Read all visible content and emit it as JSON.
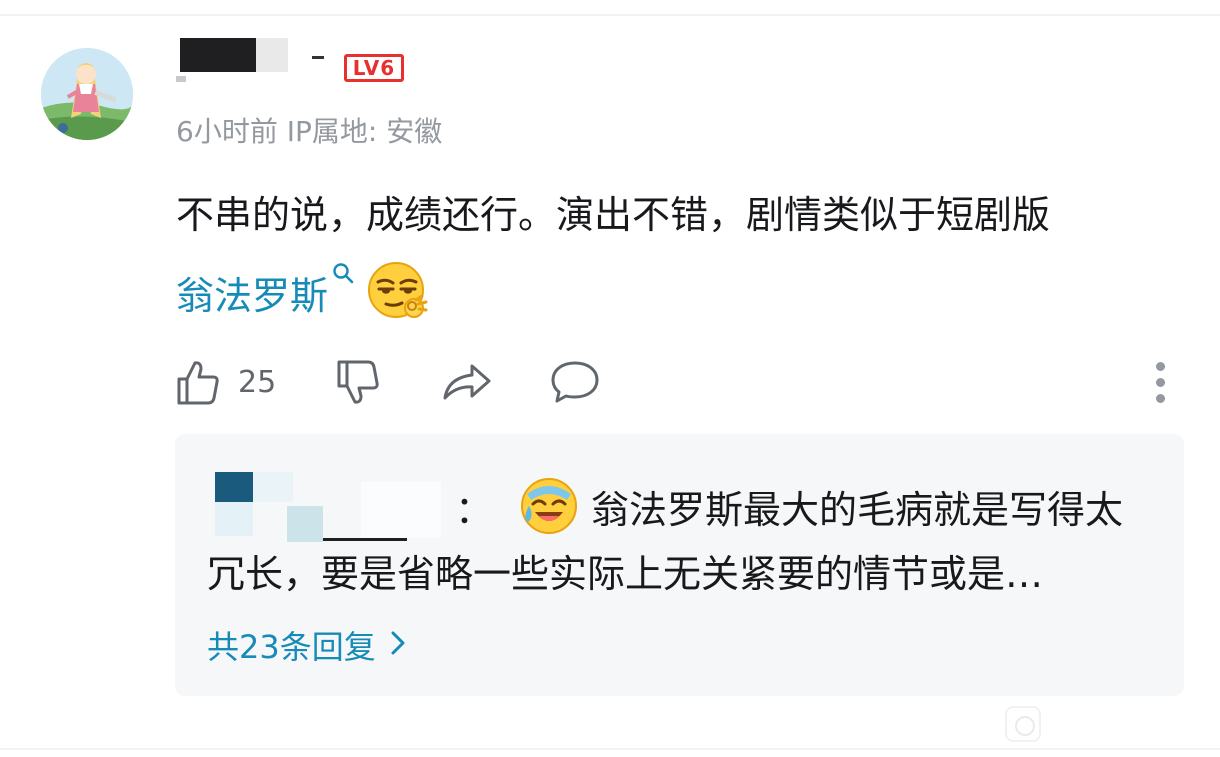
{
  "comment": {
    "level_badge": "LV6",
    "time": "6小时前",
    "ip_location": "IP属地: 安徽",
    "content_text": "不串的说，成绩还行。演出不错，剧情类似于短剧版",
    "topic_link": "翁法罗斯",
    "content_emoji_icon": "smirk-ok-emoji-icon",
    "like_count": "25"
  },
  "actions": {
    "like_icon": "thumbs-up-icon",
    "dislike_icon": "thumbs-down-icon",
    "share_icon": "share-arrow-icon",
    "reply_icon": "chat-bubble-icon",
    "more_icon": "more-vertical-dots-icon"
  },
  "reply_preview": {
    "separator": "：",
    "emoji_icon": "laughing-crying-emoji-icon",
    "text_line1": "翁法罗斯最大的毛病就是写得太",
    "text_line2": "冗长，要是省略一些实际上无关紧要的情节或是…",
    "more_replies": "共23条回复"
  },
  "colors": {
    "link": "#178bb8",
    "level_badge": "#e8302f",
    "meta_text": "#9499a0",
    "reply_bg": "#f6f7f8"
  }
}
